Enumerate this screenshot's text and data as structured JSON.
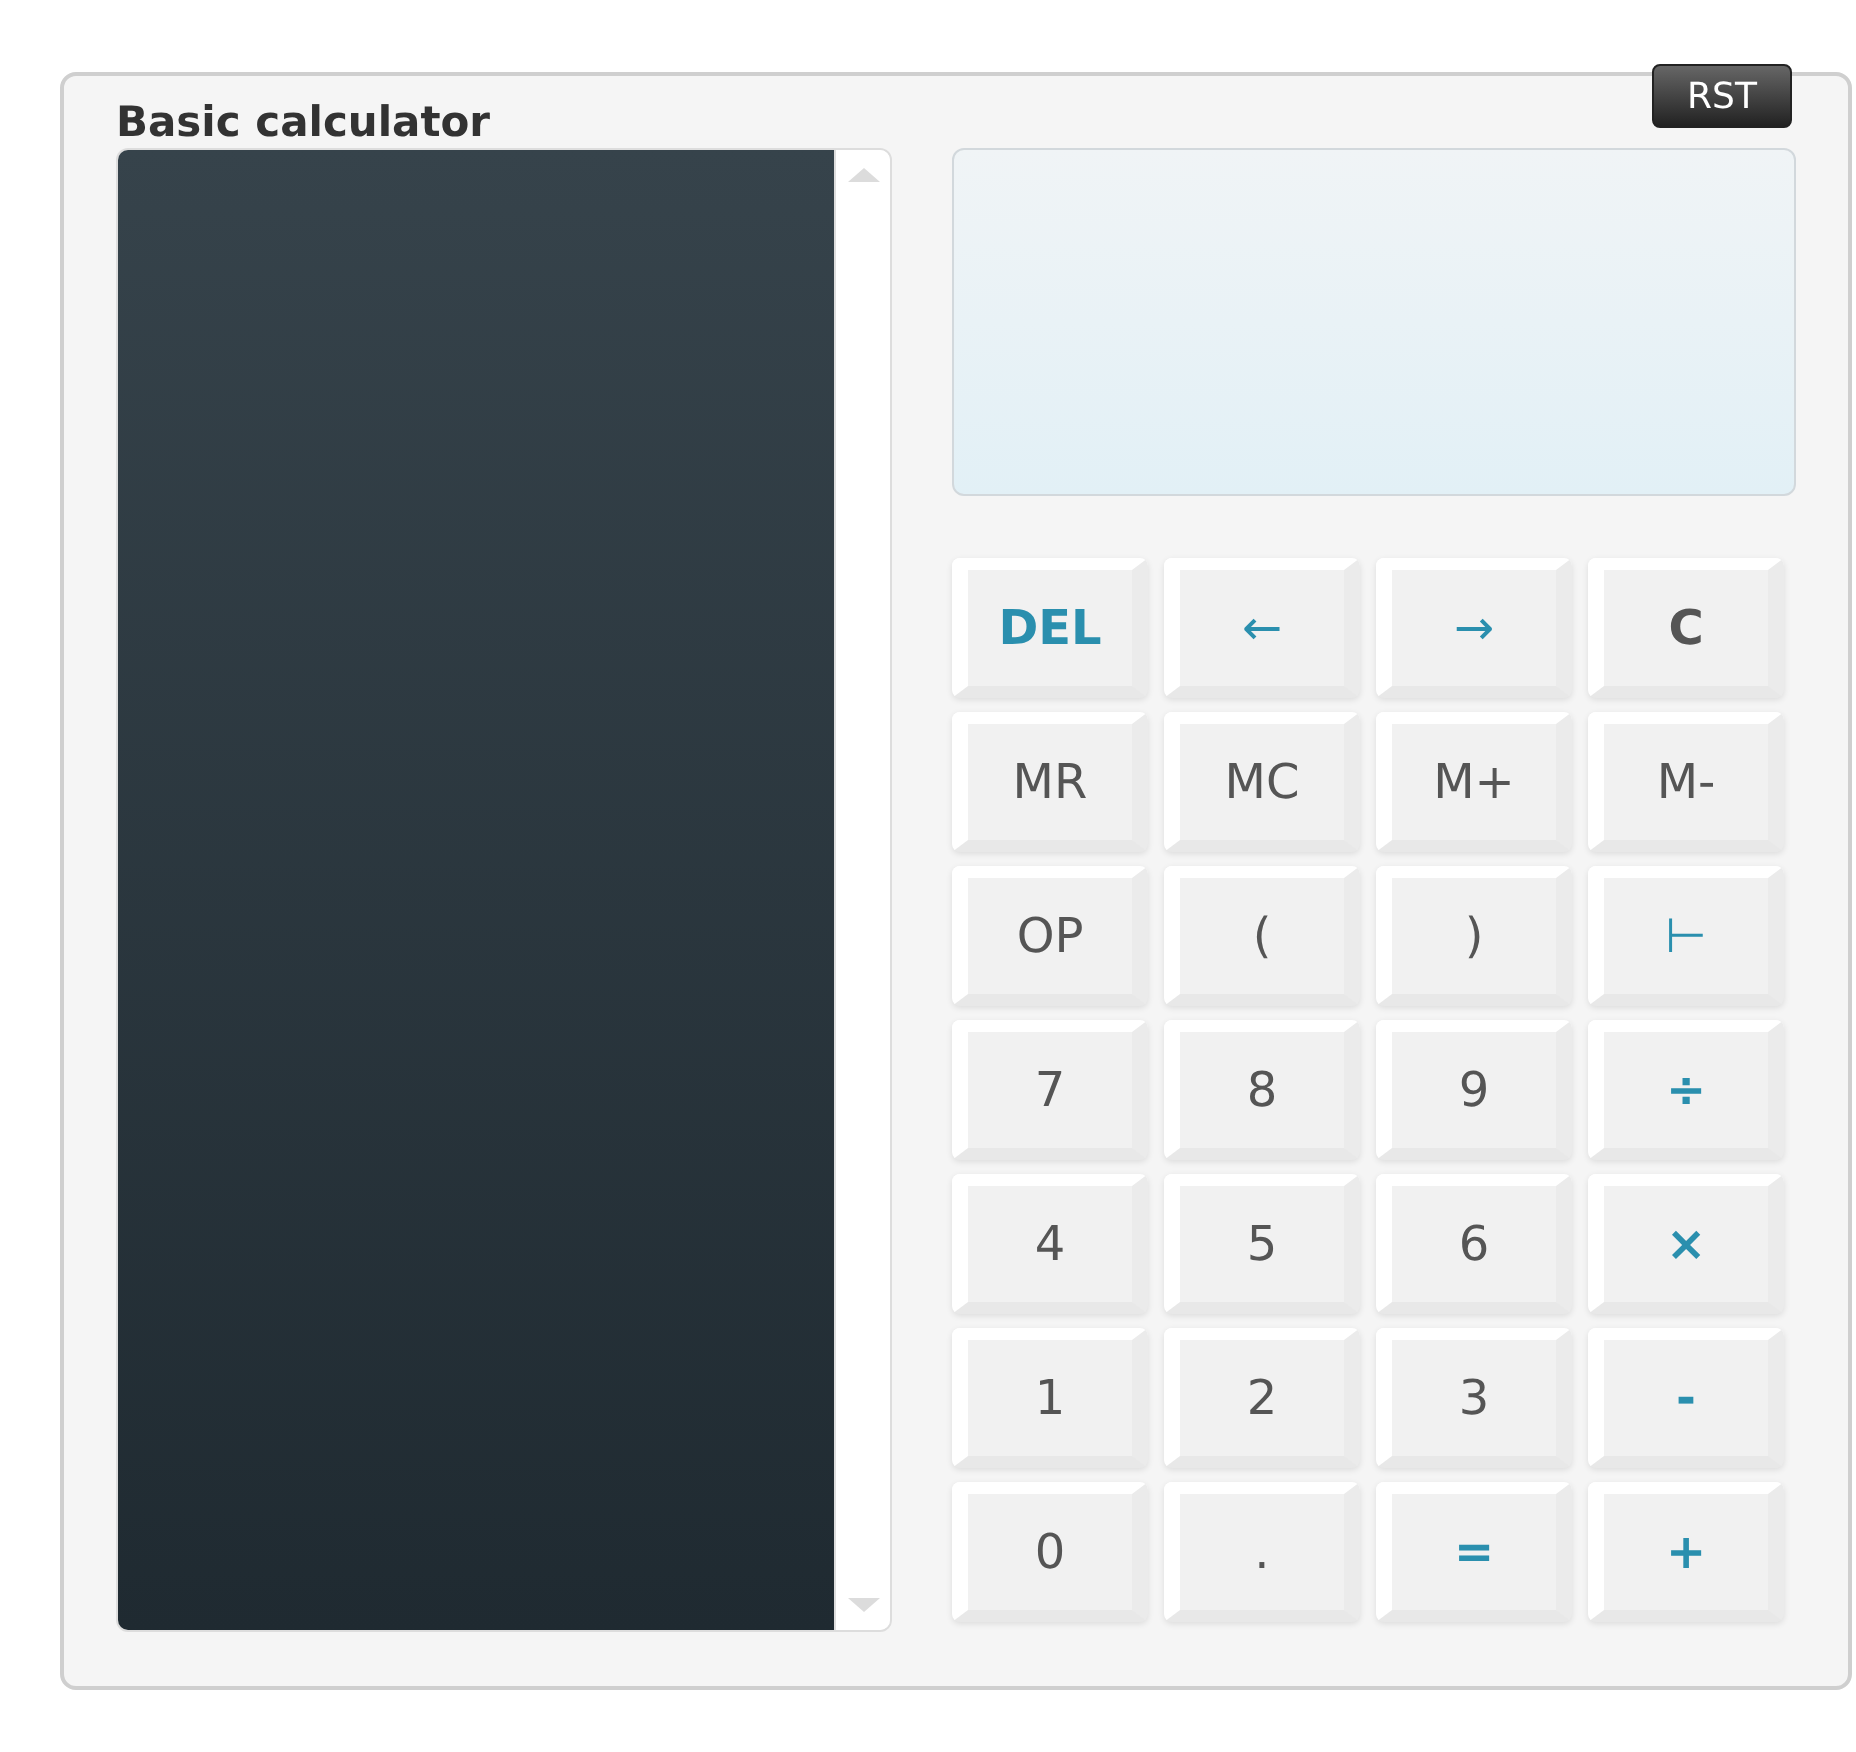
{
  "window": {
    "title": "Basic calculator"
  },
  "reset_button": {
    "label": "RST"
  },
  "keys": [
    {
      "label": "DEL",
      "kind": "accent-bold"
    },
    {
      "label": "←",
      "kind": "accent"
    },
    {
      "label": "→",
      "kind": "accent"
    },
    {
      "label": "C",
      "kind": "bold"
    },
    {
      "label": "MR",
      "kind": "plain"
    },
    {
      "label": "MC",
      "kind": "plain"
    },
    {
      "label": "M+",
      "kind": "plain"
    },
    {
      "label": "M-",
      "kind": "plain"
    },
    {
      "label": "OP",
      "kind": "plain"
    },
    {
      "label": "(",
      "kind": "plain"
    },
    {
      "label": ")",
      "kind": "plain"
    },
    {
      "label": "⊢",
      "kind": "accent"
    },
    {
      "label": "7",
      "kind": "plain"
    },
    {
      "label": "8",
      "kind": "plain"
    },
    {
      "label": "9",
      "kind": "plain"
    },
    {
      "label": "÷",
      "kind": "accent-bold"
    },
    {
      "label": "4",
      "kind": "plain"
    },
    {
      "label": "5",
      "kind": "plain"
    },
    {
      "label": "6",
      "kind": "plain"
    },
    {
      "label": "×",
      "kind": "accent-bold"
    },
    {
      "label": "1",
      "kind": "plain"
    },
    {
      "label": "2",
      "kind": "plain"
    },
    {
      "label": "3",
      "kind": "plain"
    },
    {
      "label": "-",
      "kind": "accent-bold"
    },
    {
      "label": "0",
      "kind": "plain"
    },
    {
      "label": ".",
      "kind": "plain"
    },
    {
      "label": "=",
      "kind": "accent-bold"
    },
    {
      "label": "+",
      "kind": "accent-bold"
    }
  ]
}
